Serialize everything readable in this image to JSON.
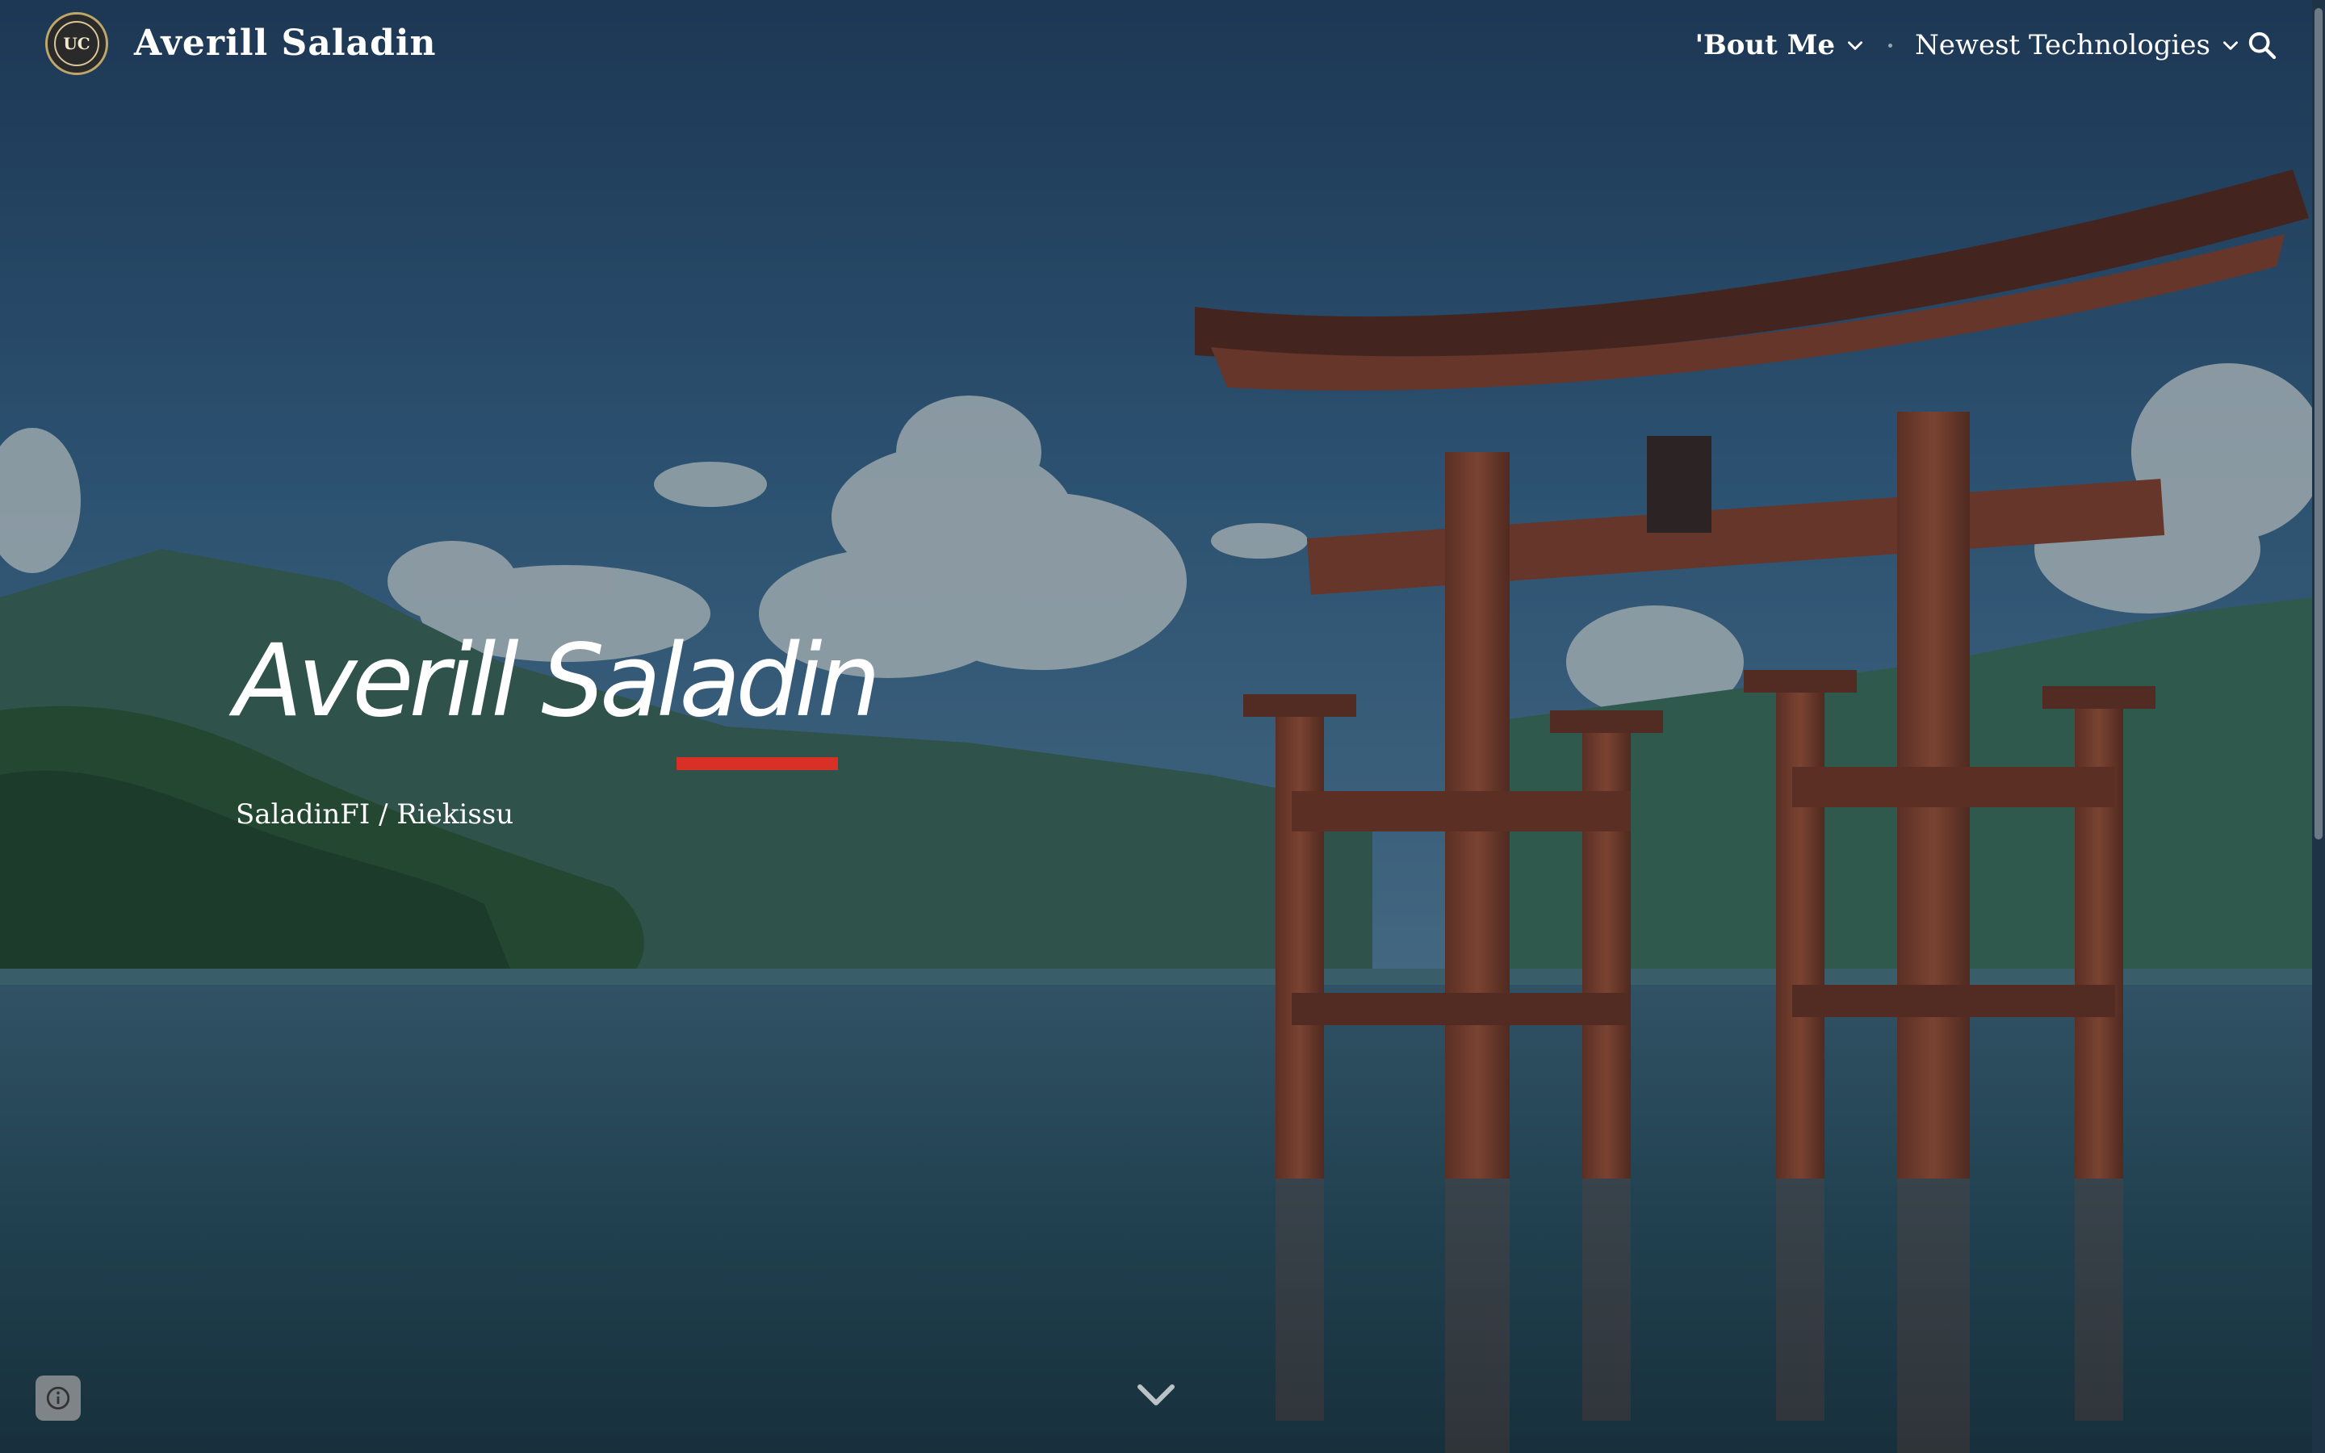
{
  "site": {
    "title": "Averill Saladin",
    "logo_text": "UC"
  },
  "nav": {
    "items": [
      {
        "label": "'Bout Me",
        "active": true,
        "icon": "chevron-down-icon"
      },
      {
        "label": "Newest Technologies",
        "active": false,
        "icon": "chevron-down-icon"
      }
    ],
    "search_icon": "search-icon"
  },
  "hero": {
    "title": "Averill Saladin",
    "subtitle": "SaladinFI / Riekissu",
    "accent_color": "#d93025",
    "scroll_icon": "chevron-down-icon"
  },
  "footer": {
    "info_icon": "info-icon"
  }
}
